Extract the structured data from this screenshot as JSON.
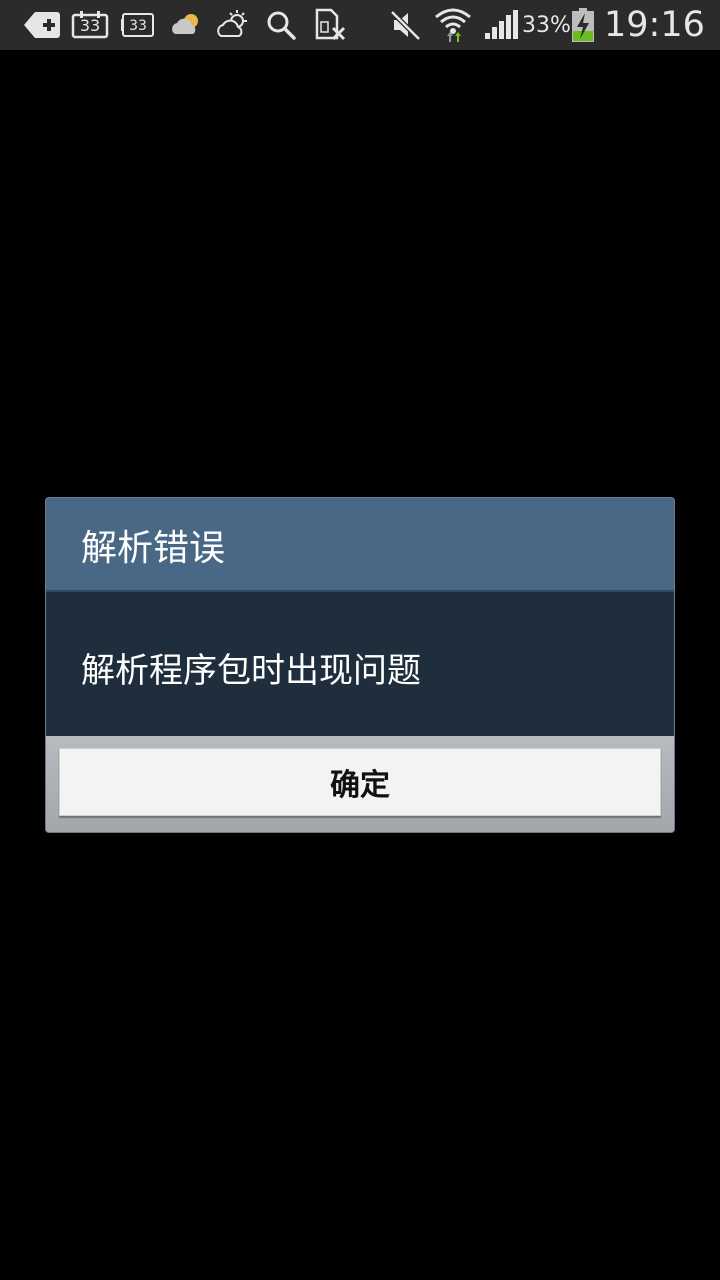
{
  "status_bar": {
    "icons": [
      "back-plus-icon",
      "calendar-33-icon",
      "calendar-box-33-icon",
      "cloudy-weather-icon",
      "partly-sunny-icon",
      "search-icon",
      "sim-blocked-icon",
      "mute-icon",
      "wifi-icon",
      "signal-icon",
      "battery-charging-icon"
    ],
    "calendar_day": "33",
    "calendar_box_day": "33",
    "battery_percent": "33%",
    "time": "19:16"
  },
  "dialog": {
    "title": "解析错误",
    "message": "解析程序包时出现问题",
    "ok_label": "确定"
  },
  "colors": {
    "status_bar_bg": "#2b2b2b",
    "dialog_header": "#486885",
    "dialog_body": "#1f2e3c",
    "dialog_footer": "#a8acb0",
    "button_bg": "#f3f3f3",
    "battery_green": "#6dbb1f",
    "wifi_arrow_green": "#7cc21b"
  }
}
